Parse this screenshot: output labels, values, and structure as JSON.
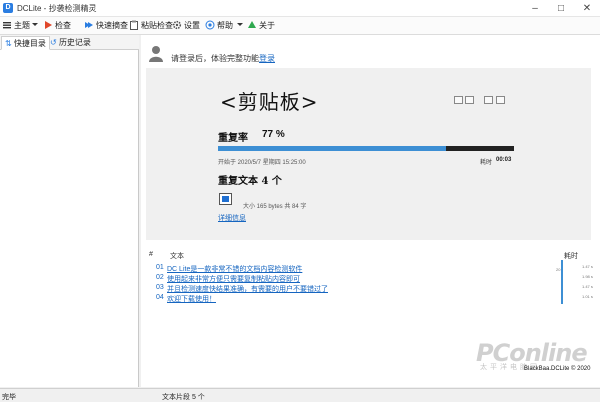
{
  "window": {
    "title": "DCLite - 抄袭检测精灵",
    "logo": "D"
  },
  "toolbar": {
    "items": [
      {
        "icon": "menu-icon",
        "label": "主题"
      },
      {
        "icon": "play-icon",
        "label": "检查"
      },
      {
        "icon": "fast-forward-icon",
        "label": "快速摘查"
      },
      {
        "icon": "clipboard-icon",
        "label": "粘贴检查"
      },
      {
        "icon": "gear-icon",
        "label": "设置"
      },
      {
        "icon": "help-icon",
        "label": "帮助"
      },
      {
        "icon": "about-icon",
        "label": "关于"
      }
    ]
  },
  "sidebar": {
    "tabs": [
      "快捷目录",
      "历史记录"
    ]
  },
  "login": {
    "text": "请登录后，体验完整功能",
    "link": "登录"
  },
  "card": {
    "title": "<剪贴板>",
    "repeat_label": "重复率",
    "repeat_value": "77 %",
    "repeat_fraction": 0.77,
    "start_time": "开始于 2020/5/7 星期四 15:25:00",
    "elapsed_label": "耗时",
    "elapsed_value": "00:03",
    "repeated_text_label": "重复文本 4 个",
    "size_line": "大小 165 bytes    共 84 字",
    "detail_link": "详细信息"
  },
  "results": {
    "columns": {
      "index": "#",
      "text": "文本",
      "time": "耗时"
    },
    "rows": [
      {
        "index": "01",
        "text": "DC Lite是一款非常不错的文档内容检测软件"
      },
      {
        "index": "02",
        "text": "使用起来非常方便只需要复制粘贴内容即可"
      },
      {
        "index": "03",
        "text": "并且检测速度快结果准确，有需要的用户不要错过了"
      },
      {
        "index": "04",
        "text": "欢迎下载使用！"
      }
    ],
    "timeline_labels": [
      "1.47 s",
      "1.98 s",
      "20",
      "1.47 s",
      "1.01 s"
    ]
  },
  "watermark": {
    "brand": "PConline",
    "sub": "太平洋电脑网"
  },
  "copyright": "BlackBaa.DCLite © 2020",
  "status": {
    "left": "完毕",
    "count": "文本片段 5 个"
  }
}
